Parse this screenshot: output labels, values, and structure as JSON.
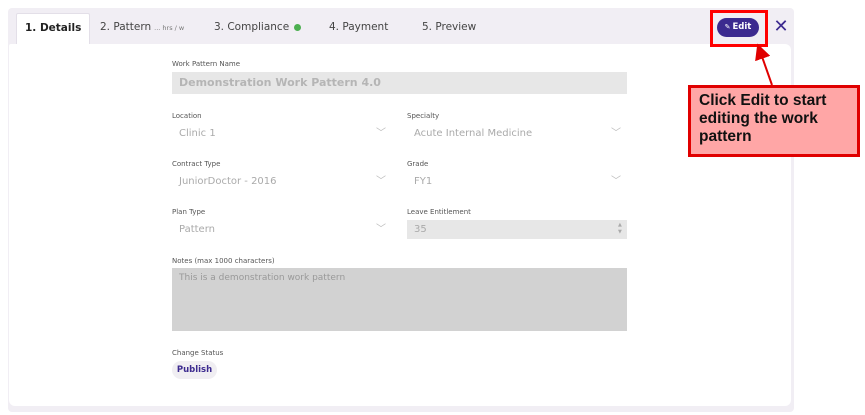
{
  "tabs": [
    {
      "label": "1. Details",
      "active": true
    },
    {
      "label": "2. Pattern",
      "sub": "... hrs / w"
    },
    {
      "label": "3. Compliance",
      "status": "complete"
    },
    {
      "label": "4. Payment"
    },
    {
      "label": "5. Preview"
    }
  ],
  "header": {
    "edit_label": "Edit",
    "edit_icon": "pencil-icon",
    "close_glyph": "✕",
    "accent_color": "#3c2a8f"
  },
  "form": {
    "work_pattern_name": {
      "label": "Work Pattern Name",
      "value": "Demonstration Work Pattern 4.0"
    },
    "location": {
      "label": "Location",
      "value": "Clinic 1"
    },
    "specialty": {
      "label": "Specialty",
      "value": "Acute Internal Medicine"
    },
    "contract_type": {
      "label": "Contract Type",
      "value": "JuniorDoctor - 2016"
    },
    "grade": {
      "label": "Grade",
      "value": "FY1"
    },
    "plan_type": {
      "label": "Plan Type",
      "value": "Pattern"
    },
    "leave_entitlement": {
      "label": "Leave Entitlement",
      "value": "35"
    },
    "notes": {
      "label": "Notes (max 1000 characters)",
      "value": "This is a demonstration work pattern"
    },
    "change_status": {
      "label": "Change Status",
      "button": "Publish"
    }
  },
  "annotation": {
    "text": "Click Edit to start editing the work pattern",
    "highlight_color": "#ff0000",
    "fill_color": "#ffa6a6"
  }
}
